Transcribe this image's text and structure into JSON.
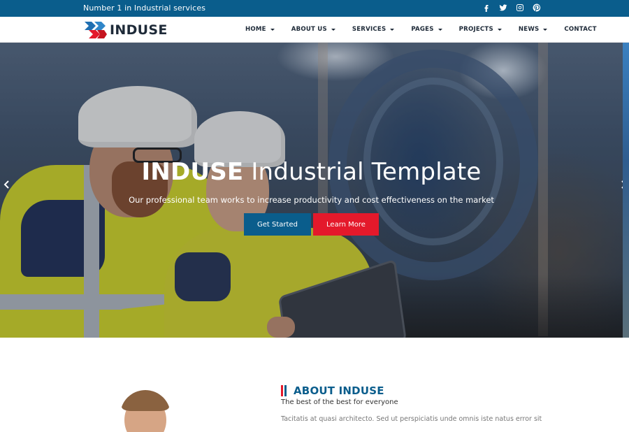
{
  "topbar": {
    "tagline": "Number 1 in Industrial services",
    "socials": [
      "facebook-icon",
      "twitter-icon",
      "instagram-icon",
      "pinterest-icon"
    ],
    "background": "#0a5d8c"
  },
  "brand": {
    "name": "INDUSE",
    "colors": {
      "primary": "#0a5d8c",
      "accent": "#e4192b",
      "dark": "#1e2a38"
    }
  },
  "nav": {
    "items": [
      {
        "label": "HOME",
        "has_dropdown": true
      },
      {
        "label": "ABOUT US",
        "has_dropdown": true
      },
      {
        "label": "SERVICES",
        "has_dropdown": true
      },
      {
        "label": "PAGES",
        "has_dropdown": true
      },
      {
        "label": "PROJECTS",
        "has_dropdown": true
      },
      {
        "label": "NEWS",
        "has_dropdown": true
      },
      {
        "label": "CONTACT",
        "has_dropdown": false
      }
    ]
  },
  "hero": {
    "title_strong": "INDUSE",
    "title_light": " Industrial Template",
    "subtitle": "Our professional team works to increase productivity and cost effectiveness on the market",
    "primary_button": "Get Started",
    "secondary_button": "Learn More",
    "prev_icon": "chevron-left-icon",
    "next_icon": "chevron-right-icon"
  },
  "about": {
    "title": "ABOUT INDUSE",
    "tagline": "The best of the best for everyone",
    "text_partial": "Tacitatis at quasi architecto. Sed ut perspiciatis unde omnis iste natus error sit"
  }
}
